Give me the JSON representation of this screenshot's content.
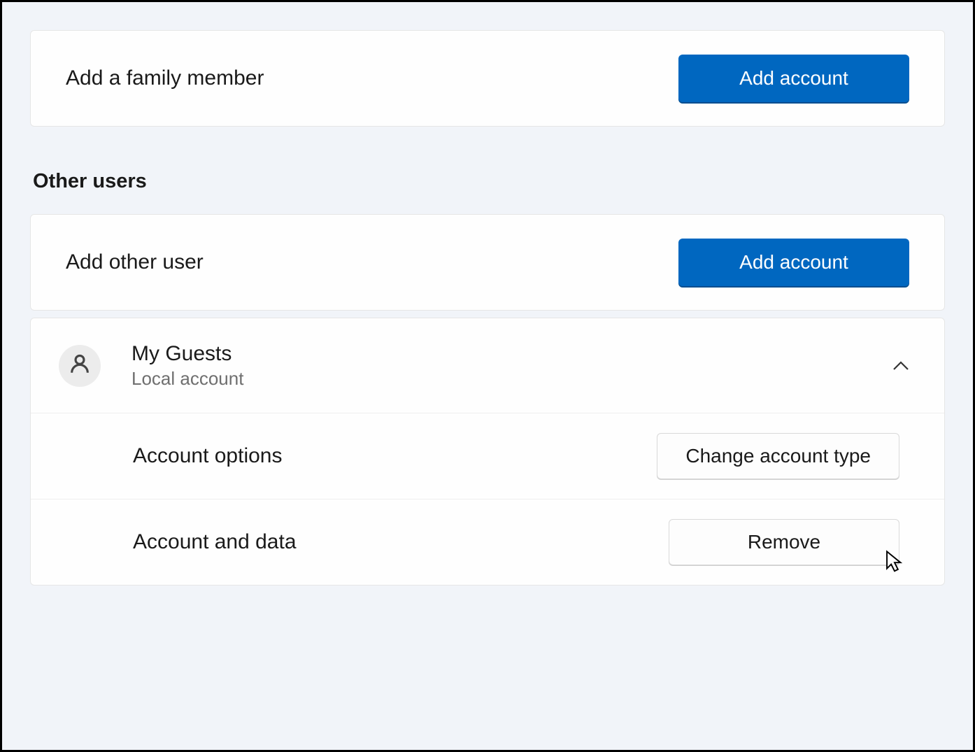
{
  "family": {
    "add_label": "Add a family member",
    "add_button": "Add account"
  },
  "other_users": {
    "heading": "Other users",
    "add_label": "Add other user",
    "add_button": "Add account",
    "user": {
      "name": "My Guests",
      "subtitle": "Local account",
      "options_label": "Account options",
      "change_type_button": "Change account type",
      "data_label": "Account and data",
      "remove_button": "Remove"
    }
  }
}
